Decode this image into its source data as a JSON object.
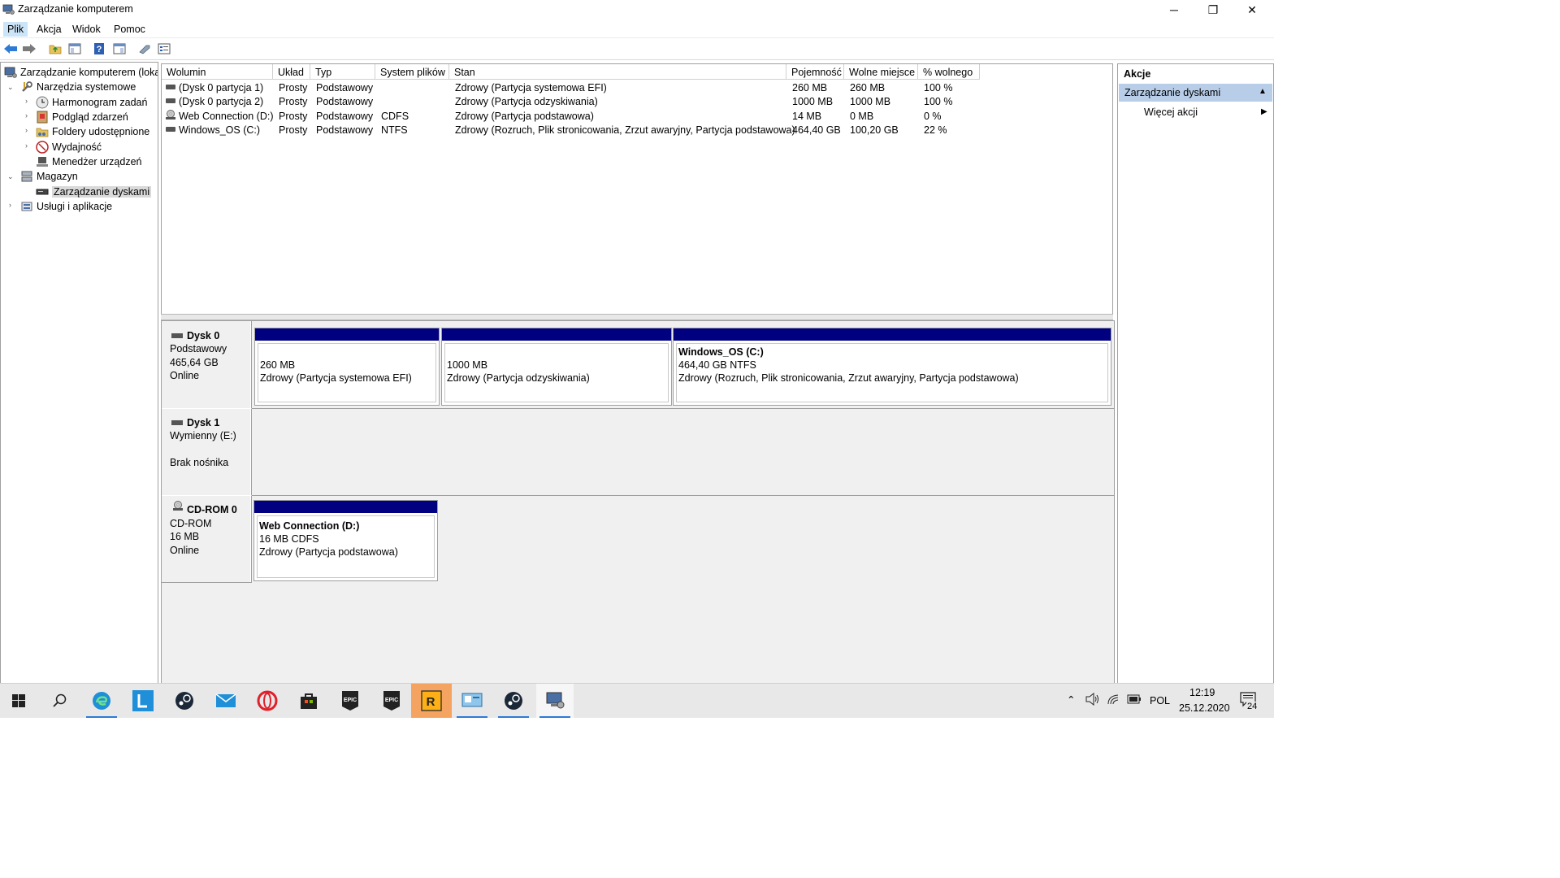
{
  "window": {
    "title": "Zarządzanie komputerem",
    "minimize": "─",
    "restore": "❐",
    "close": "✕"
  },
  "menu": [
    "Plik",
    "Akcja",
    "Widok",
    "Pomoc"
  ],
  "tree": {
    "root": "Zarządzanie komputerem (lokal",
    "system_tools": "Narzędzia systemowe",
    "task_scheduler": "Harmonogram zadań",
    "event_viewer": "Podgląd zdarzeń",
    "shared_folders": "Foldery udostępnione",
    "performance": "Wydajność",
    "device_manager": "Menedżer urządzeń",
    "storage": "Magazyn",
    "disk_management": "Zarządzanie dyskami",
    "services": "Usługi i aplikacje"
  },
  "volumes": {
    "headers": [
      "Wolumin",
      "Układ",
      "Typ",
      "System plików",
      "Stan",
      "Pojemność",
      "Wolne miejsce",
      "% wolnego"
    ],
    "rows": [
      [
        "(Dysk 0 partycja 1)",
        "Prosty",
        "Podstawowy",
        "",
        "Zdrowy (Partycja systemowa EFI)",
        "260 MB",
        "260 MB",
        "100 %"
      ],
      [
        "(Dysk 0 partycja 2)",
        "Prosty",
        "Podstawowy",
        "",
        "Zdrowy (Partycja odzyskiwania)",
        "1000 MB",
        "1000 MB",
        "100 %"
      ],
      [
        "Web Connection (D:)",
        "Prosty",
        "Podstawowy",
        "CDFS",
        "Zdrowy (Partycja podstawowa)",
        "14 MB",
        "0 MB",
        "0 %"
      ],
      [
        "Windows_OS (C:)",
        "Prosty",
        "Podstawowy",
        "NTFS",
        "Zdrowy (Rozruch, Plik stronicowania, Zrzut awaryjny, Partycja podstawowa)",
        "464,40 GB",
        "100,20 GB",
        "22 %"
      ]
    ]
  },
  "disks": {
    "disk0": {
      "name": "Dysk 0",
      "type": "Podstawowy",
      "size": "465,64 GB",
      "status": "Online",
      "p1": {
        "size": "260 MB",
        "status": "Zdrowy (Partycja systemowa EFI)"
      },
      "p2": {
        "size": "1000 MB",
        "status": "Zdrowy (Partycja odzyskiwania)"
      },
      "p3": {
        "name": "Windows_OS  (C:)",
        "size": "464,40 GB NTFS",
        "status": "Zdrowy (Rozruch, Plik stronicowania, Zrzut awaryjny, Partycja podstawowa)"
      }
    },
    "disk1": {
      "name": "Dysk 1",
      "type": "Wymienny (E:)",
      "media": "Brak nośnika"
    },
    "cdrom0": {
      "name": "CD-ROM 0",
      "type": "CD-ROM",
      "size": "16 MB",
      "status": "Online",
      "p1": {
        "name": "Web Connection  (D:)",
        "size": "16 MB CDFS",
        "status": "Zdrowy (Partycja podstawowa)"
      }
    }
  },
  "actions": {
    "title": "Akcje",
    "section": "Zarządzanie dyskami",
    "more": "Więcej akcji"
  },
  "taskbar": {
    "lang": "POL",
    "time": "12:19",
    "date": "25.12.2020",
    "notif_count": "24"
  },
  "colors": {
    "partition_bar": "#000080",
    "action_section": "#b8cde8",
    "taskbar": "#e8e8e8"
  }
}
